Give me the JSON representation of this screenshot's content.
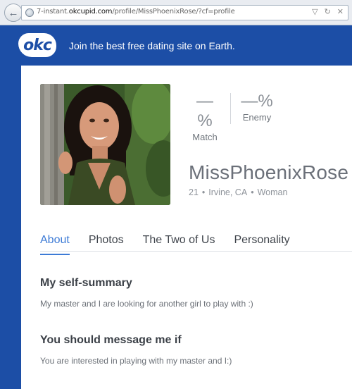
{
  "browser": {
    "url_prefix": "7-instant.",
    "url_domain": "okcupid.com",
    "url_path": "/profile/MissPhoenixRose/?cf=profile"
  },
  "header": {
    "logo_text": "okc",
    "tagline": "Join the best free dating site on Earth."
  },
  "stats": {
    "match_value": "—%",
    "match_label": "Match",
    "enemy_value": "—%",
    "enemy_label": "Enemy"
  },
  "profile": {
    "username": "MissPhoenixRose",
    "age": "21",
    "location": "Irvine, CA",
    "gender": "Woman",
    "separator": "•"
  },
  "tabs": [
    "About",
    "Photos",
    "The Two of Us",
    "Personality"
  ],
  "essays": [
    {
      "heading": "My self-summary",
      "text": "My master and I are looking for another girl to play with :)"
    },
    {
      "heading": "You should message me if",
      "text": "You are interested in playing with my master and I:)"
    }
  ],
  "colors": {
    "brand_blue": "#1c4ea6",
    "active_tab": "#3d7bd6"
  }
}
